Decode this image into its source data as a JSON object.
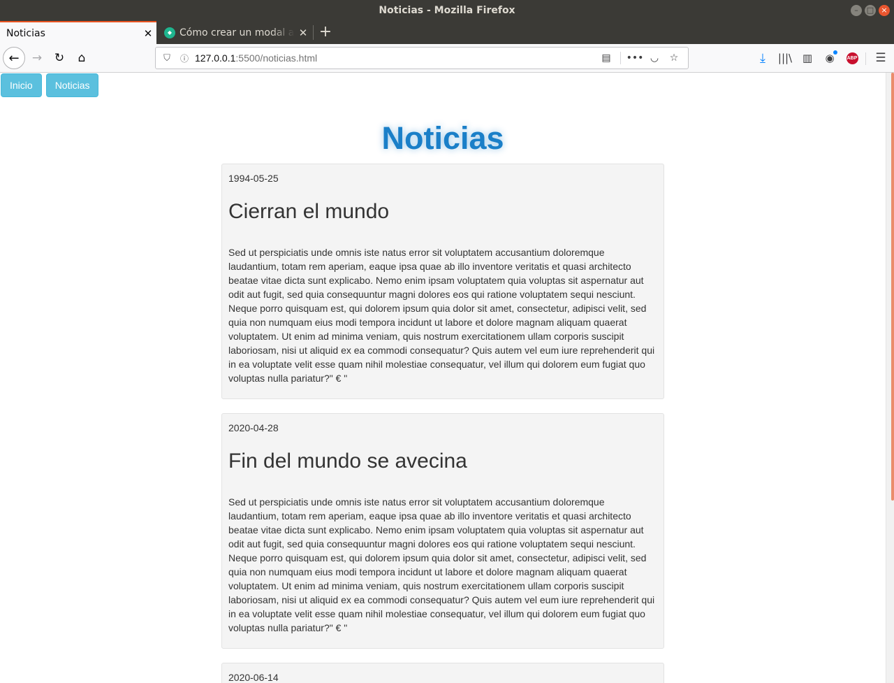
{
  "window": {
    "title": "Noticias - Mozilla Firefox",
    "controls": [
      "–",
      "□",
      "×"
    ]
  },
  "tabs": [
    {
      "label": "Noticias",
      "active": true
    },
    {
      "label": "Cómo crear un modal a partir",
      "active": false
    }
  ],
  "navbar": {
    "url_host": "127.0.0.1",
    "url_rest": ":5500/noticias.html"
  },
  "page": {
    "nav_buttons": [
      "Inicio",
      "Noticias"
    ],
    "title": "Noticias",
    "news": [
      {
        "date": "1994-05-25",
        "title": "Cierran el mundo",
        "body": "Sed ut perspiciatis unde omnis iste natus error sit voluptatem accusantium doloremque laudantium, totam rem aperiam, eaque ipsa quae ab illo inventore veritatis et quasi architecto beatae vitae dicta sunt explicabo. Nemo enim ipsam voluptatem quia voluptas sit aspernatur aut odit aut fugit, sed quia consequuntur magni dolores eos qui ratione voluptatem sequi nesciunt. Neque porro quisquam est, qui dolorem ipsum quia dolor sit amet, consectetur, adipisci velit, sed quia non numquam eius modi tempora incidunt ut labore et dolore magnam aliquam quaerat voluptatem. Ut enim ad minima veniam, quis nostrum exercitationem ullam corporis suscipit laboriosam, nisi ut aliquid ex ea commodi consequatur? Quis autem vel eum iure reprehenderit qui in ea voluptate velit esse quam nihil molestiae consequatur, vel illum qui dolorem eum fugiat quo voluptas nulla pariatur?\" € \""
      },
      {
        "date": "2020-04-28",
        "title": "Fin del mundo se avecina",
        "body": "Sed ut perspiciatis unde omnis iste natus error sit voluptatem accusantium doloremque laudantium, totam rem aperiam, eaque ipsa quae ab illo inventore veritatis et quasi architecto beatae vitae dicta sunt explicabo. Nemo enim ipsam voluptatem quia voluptas sit aspernatur aut odit aut fugit, sed quia consequuntur magni dolores eos qui ratione voluptatem sequi nesciunt. Neque porro quisquam est, qui dolorem ipsum quia dolor sit amet, consectetur, adipisci velit, sed quia non numquam eius modi tempora incidunt ut labore et dolore magnam aliquam quaerat voluptatem. Ut enim ad minima veniam, quis nostrum exercitationem ullam corporis suscipit laboriosam, nisi ut aliquid ex ea commodi consequatur? Quis autem vel eum iure reprehenderit qui in ea voluptate velit esse quam nihil molestiae consequatur, vel illum qui dolorem eum fugiat quo voluptas nulla pariatur?\" € \""
      },
      {
        "date": "2020-06-14"
      }
    ]
  },
  "colors": {
    "accent": "#e95420",
    "button": "#5bc0de",
    "title": "#1a7fc8",
    "card_bg": "#f4f4f4"
  }
}
